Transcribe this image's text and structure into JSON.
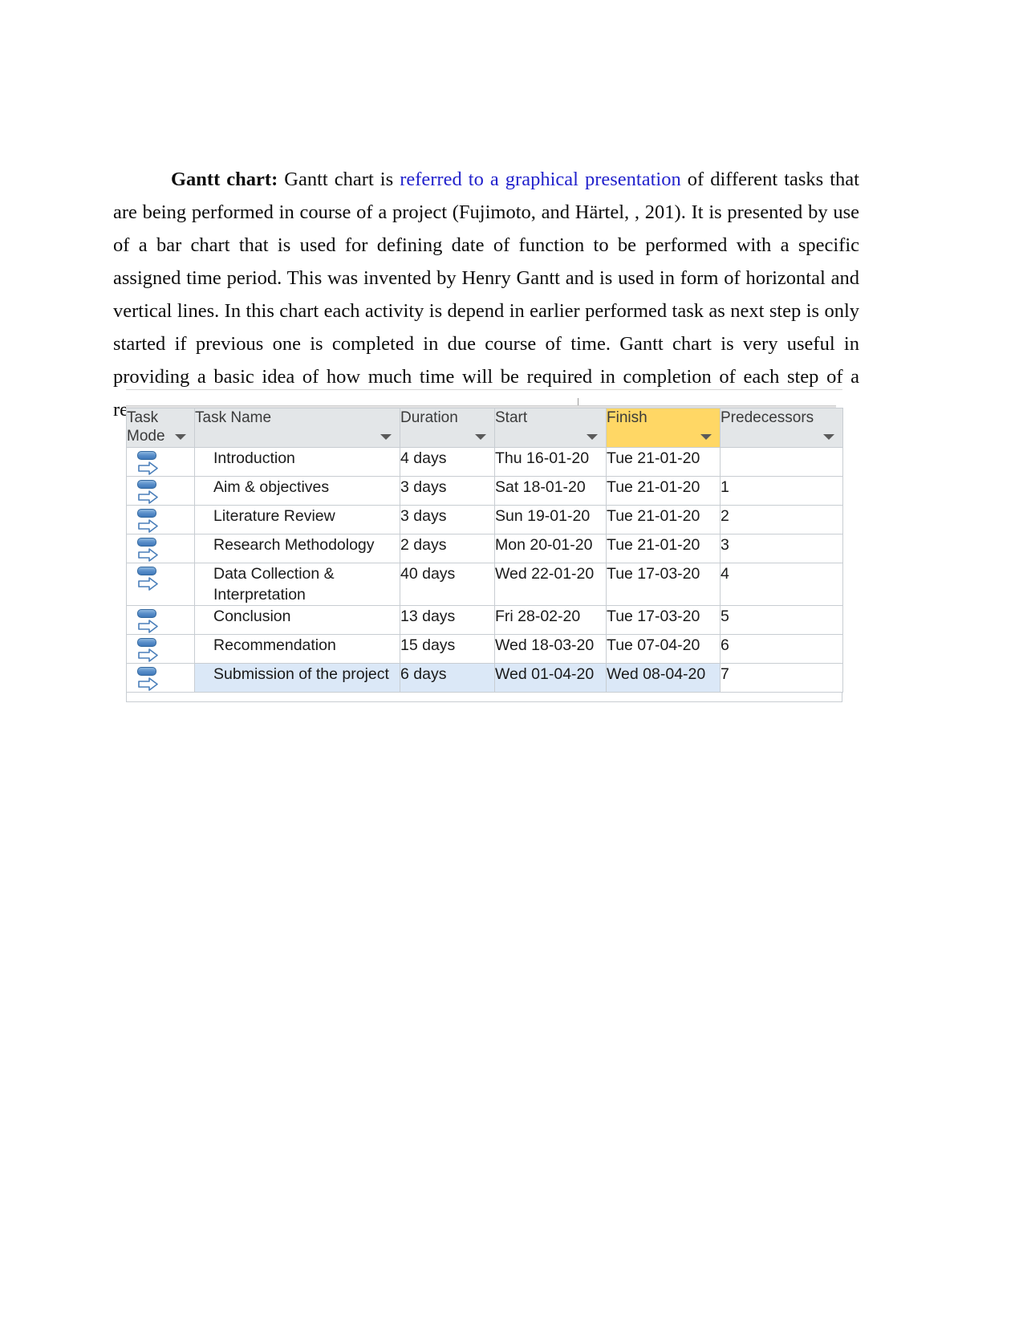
{
  "document": {
    "paragraph": {
      "lead_label": "Gantt chart:",
      "segment_1": " Gantt chart is ",
      "link": "referred to a graphical presentation",
      "segment_2": " of different tasks that are being performed in course of a project (Fujimoto,  and Härtel, , 201). It is presented by use of a bar chart that is used for defining date of function to be performed with a specific assigned time period. This was invented by Henry Gantt and is used in form of horizontal and vertical lines. In this chart each activity is depend in earlier performed task as next step is only started if previous one is completed in due course of time. Gantt chart is very useful in providing a basic idea of how much time will be required in completion of each step of a research project."
    }
  },
  "project_table": {
    "headers": [
      {
        "label": "Task Mode",
        "highlighted": false,
        "filter": "filter-arrow"
      },
      {
        "label": "Task Name",
        "highlighted": false,
        "filter": "filter-arrow"
      },
      {
        "label": "Duration",
        "highlighted": false,
        "filter": "filter-arrow"
      },
      {
        "label": "Start",
        "highlighted": false,
        "filter": "filter-arrow"
      },
      {
        "label": "Finish",
        "highlighted": true,
        "filter": "filter-arrow"
      },
      {
        "label": "Predecessors",
        "highlighted": false,
        "filter": "filter-arrow"
      }
    ],
    "highlight_color": "#ffd765",
    "header_background": "#e3e6e8",
    "selection_color": "#dbe8f7",
    "task_mode_icon": "auto-scheduled-icon",
    "rows": [
      {
        "mode_icon": "auto-scheduled-icon",
        "name": "Introduction",
        "duration": "4 days",
        "start": "Thu 16-01-20",
        "finish": "Tue 21-01-20",
        "predecessors": "",
        "selected": false
      },
      {
        "mode_icon": "auto-scheduled-icon",
        "name": "Aim & objectives",
        "duration": "3 days",
        "start": "Sat 18-01-20",
        "finish": "Tue 21-01-20",
        "predecessors": "1",
        "selected": false
      },
      {
        "mode_icon": "auto-scheduled-icon",
        "name": "Literature Review",
        "duration": "3 days",
        "start": "Sun 19-01-20",
        "finish": "Tue 21-01-20",
        "predecessors": "2",
        "selected": false
      },
      {
        "mode_icon": "auto-scheduled-icon",
        "name": "Research Methodology",
        "duration": "2 days",
        "start": "Mon 20-01-20",
        "finish": "Tue 21-01-20",
        "predecessors": "3",
        "selected": false
      },
      {
        "mode_icon": "auto-scheduled-icon",
        "name": "Data Collection & Interpretation",
        "duration": "40 days",
        "start": "Wed 22-01-20",
        "finish": "Tue 17-03-20",
        "predecessors": "4",
        "selected": false
      },
      {
        "mode_icon": "auto-scheduled-icon",
        "name": "Conclusion",
        "duration": "13 days",
        "start": "Fri 28-02-20",
        "finish": "Tue 17-03-20",
        "predecessors": "5",
        "selected": false
      },
      {
        "mode_icon": "auto-scheduled-icon",
        "name": "Recommendation",
        "duration": "15 days",
        "start": "Wed 18-03-20",
        "finish": "Tue 07-04-20",
        "predecessors": "6",
        "selected": false
      },
      {
        "mode_icon": "auto-scheduled-icon",
        "name": "Submission of the project",
        "duration": "6 days",
        "start": "Wed 01-04-20",
        "finish": "Wed 08-04-20",
        "predecessors": "7",
        "selected": true
      }
    ]
  }
}
